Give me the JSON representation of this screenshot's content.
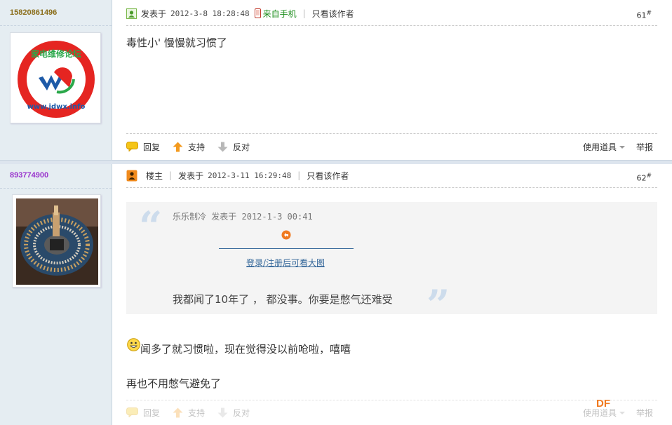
{
  "posts": [
    {
      "username": "15820861496",
      "username_color": "#8a6d1a",
      "posted_label": "发表于",
      "date": "2012-3-8 18:28:48",
      "source_label": "来自手机",
      "author_only": "只看该作者",
      "floor": "61",
      "floor_mark": "#",
      "message": "毒性小' 慢慢就习惯了",
      "avatar_text_top": "家电维修论坛",
      "avatar_text_bottom": "www.jdwx.info",
      "actions": {
        "reply": "回复",
        "support": "支持",
        "oppose": "反对",
        "tools": "使用道具",
        "report": "举报"
      }
    },
    {
      "username": "893774900",
      "username_color": "#9933cc",
      "owner_label": "楼主",
      "posted_label": "发表于",
      "date": "2012-3-11 16:29:48",
      "author_only": "只看该作者",
      "floor": "62",
      "floor_mark": "#",
      "quote": {
        "author": "乐乐制冷",
        "posted_label": "发表于",
        "date": "2012-1-3 00:41",
        "image_link": "登录/注册后可看大图",
        "text": "我都闻了10年了 ， 都没事。你要是憋气还难受"
      },
      "message_line1": "闻多了就习惯啦，现在觉得没以前呛啦，嘻嘻",
      "message_line2": "再也不用憋气避免了",
      "actions": {
        "reply": "回复",
        "support": "支持",
        "oppose": "反对",
        "tools": "使用道具",
        "report": "举报"
      }
    }
  ],
  "watermark": "DF",
  "colors": {
    "sidebar": "#e5edf2",
    "link": "#336699",
    "green": "#1a8c1a",
    "orange": "#f07a20"
  }
}
